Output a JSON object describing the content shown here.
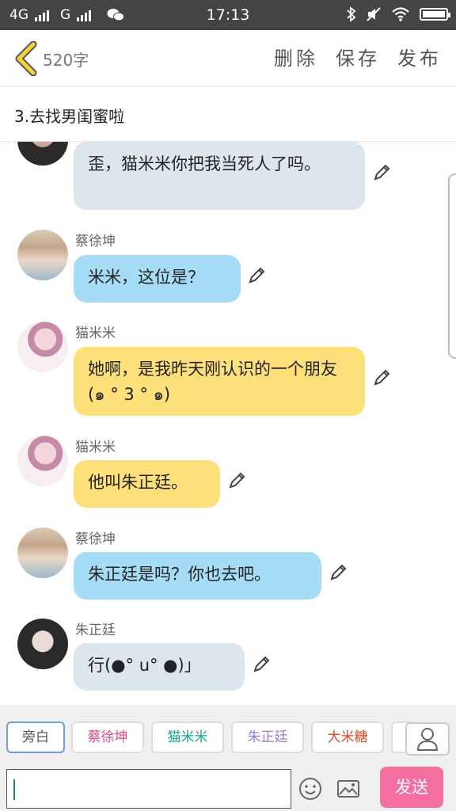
{
  "status": {
    "net1": "4G",
    "net2": "G",
    "time": "17:13"
  },
  "header": {
    "word_count": "520字",
    "delete_label": "删除",
    "save_label": "保存",
    "publish_label": "发布"
  },
  "chapter": {
    "title": "3.去找男闺蜜啦"
  },
  "messages": [
    {
      "speaker": "",
      "text": "歪，猫米米你把我当死人了吗。",
      "bubble_color": "#dde6ec"
    },
    {
      "speaker": "蔡徐坤",
      "text": "米米，这位是？",
      "bubble_color": "#a6dcf5"
    },
    {
      "speaker": "猫米米",
      "text": "她啊，是我昨天刚认识的一个朋友(๑ ° 3 ° ๑)",
      "bubble_color": "#fde07a"
    },
    {
      "speaker": "猫米米",
      "text": "他叫朱正廷。",
      "bubble_color": "#fde07a"
    },
    {
      "speaker": "蔡徐坤",
      "text": "朱正廷是吗？你也去吧。",
      "bubble_color": "#a6dcf5"
    },
    {
      "speaker": "朱正廷",
      "text": "行(●° u° ●)」",
      "bubble_color": "#dde6ec"
    }
  ],
  "characters": [
    {
      "label": "旁白",
      "color": "#555555"
    },
    {
      "label": "蔡徐坤",
      "color": "#e04a8a"
    },
    {
      "label": "猫米米",
      "color": "#1aa58f"
    },
    {
      "label": "朱正廷",
      "color": "#a07ac8"
    },
    {
      "label": "大米糖",
      "color": "#d64a2a"
    }
  ],
  "input": {
    "value": "",
    "send_label": "发送"
  },
  "icons": {
    "back": "chevron-left-icon",
    "edit": "pencil-icon",
    "emoji": "emoji-icon",
    "image": "image-icon",
    "user": "user-icon"
  },
  "colors": {
    "accent": "#f36fa0",
    "back_chevron": "#f5d23a"
  }
}
